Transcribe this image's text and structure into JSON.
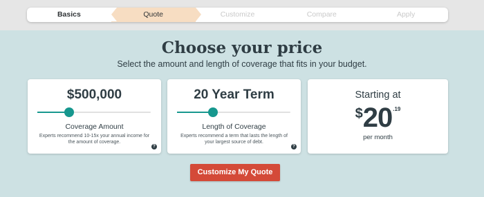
{
  "steps": [
    "Basics",
    "Quote",
    "Customize",
    "Compare",
    "Apply"
  ],
  "active_step": "Quote",
  "heading": "Choose your price",
  "subheading": "Select the amount and length of coverage that fits in your budget.",
  "coverage": {
    "amount": "$500,000",
    "label": "Coverage Amount",
    "description": "Experts recommend 10-15x your annual income for the amount of coverage.",
    "slider_fraction": 0.28,
    "help": "?"
  },
  "term": {
    "amount": "20 Year Term",
    "label": "Length of Coverage",
    "description": "Experts recommend a term that lasts the length of your largest source of debt.",
    "slider_fraction": 0.32,
    "help": "?"
  },
  "quote": {
    "starting_at": "Starting at",
    "currency": "$",
    "dollars": "20",
    "cents": ".19",
    "per_month": "per month"
  },
  "cta_label": "Customize My Quote",
  "colors": {
    "accent": "#16978e",
    "cta": "#d44a38",
    "active_step": "#f7ddc2",
    "background": "#cde1e3"
  }
}
